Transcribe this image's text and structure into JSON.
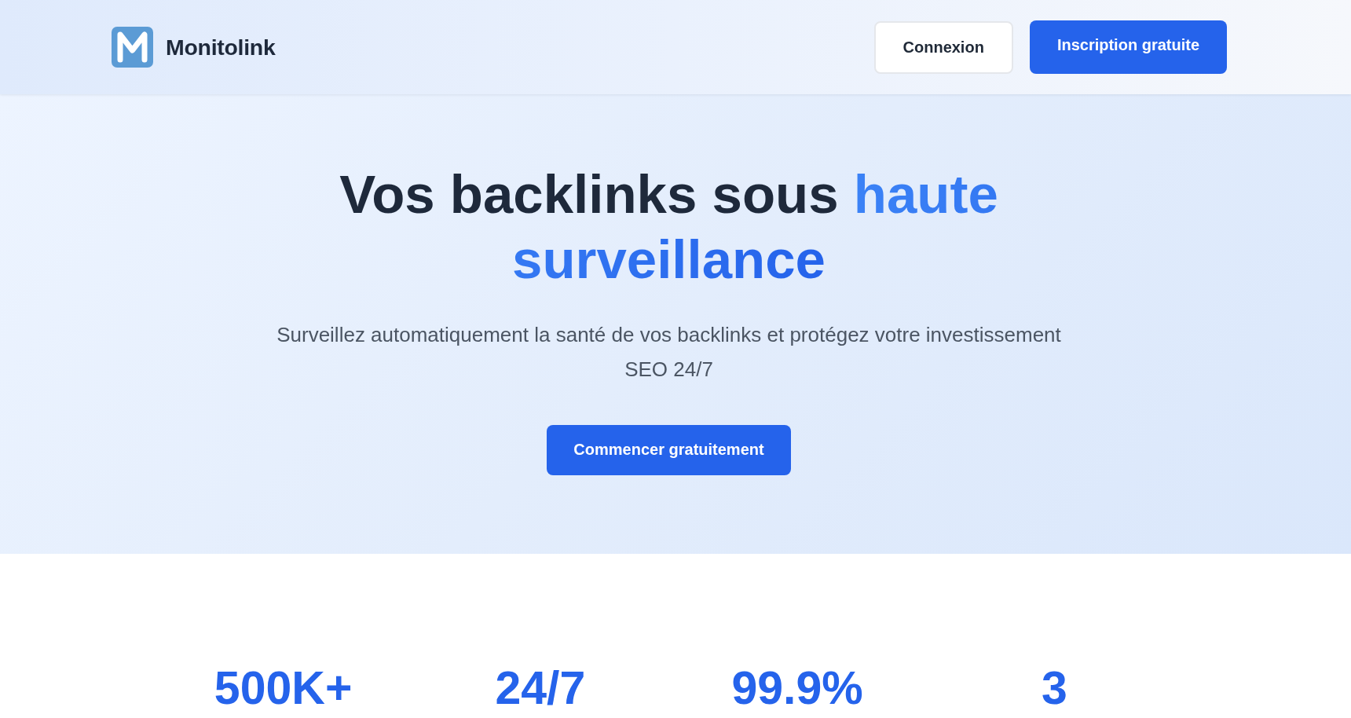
{
  "header": {
    "brand": "Monitolink",
    "buttons": [
      {
        "label": "Connexion",
        "kind": "outline"
      },
      {
        "label": "Inscription gratuite",
        "kind": "filled"
      }
    ]
  },
  "hero": {
    "title": "Vos backlinks sous",
    "title_highlight": "haute surveillance",
    "subtitle": "Surveillez automatiquement la santé de vos backlinks et protégez votre investissement SEO 24/7",
    "cta": "Commencer gratuitement"
  },
  "stats": [
    {
      "value": "500K+"
    },
    {
      "value": "24/7"
    },
    {
      "value": "99.9%"
    },
    {
      "value": "3"
    }
  ]
}
